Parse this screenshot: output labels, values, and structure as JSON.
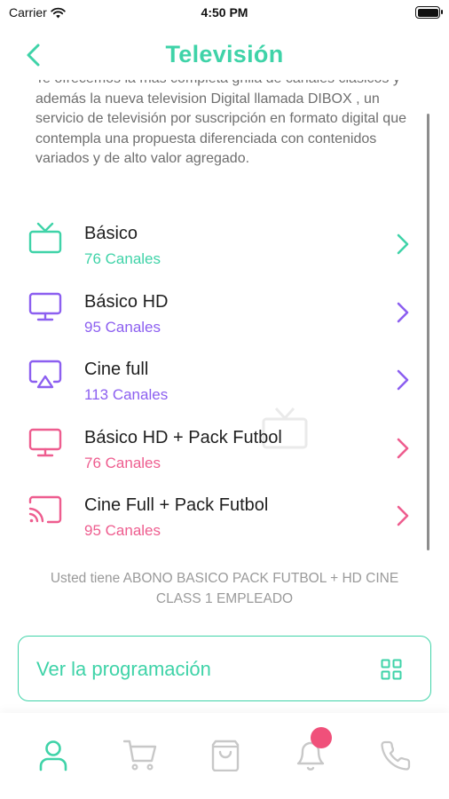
{
  "status_bar": {
    "carrier": "Carrier",
    "time": "4:50 PM"
  },
  "header": {
    "title": "Televisión"
  },
  "description": "Te ofrecemos la más completa grilla de canales clásicos y además la nueva television Digital llamada DIBOX , un servicio de televisión por suscripción en formato digital que contempla una propuesta diferenciada con contenidos variados y de alto valor agregado.",
  "channels": [
    {
      "name": "Básico",
      "count": "76 Canales",
      "color": "#3fd3a8",
      "icon": "tv-icon"
    },
    {
      "name": "Básico HD",
      "count": "95 Canales",
      "color": "#8c5ff0",
      "icon": "monitor-icon"
    },
    {
      "name": "Cine full",
      "count": "113 Canales",
      "color": "#8c5ff0",
      "icon": "airplay-icon"
    },
    {
      "name": "Básico HD + Pack Futbol",
      "count": "76 Canales",
      "color": "#ee5d8f",
      "icon": "monitor-icon"
    },
    {
      "name": "Cine Full + Pack Futbol",
      "count": "95 Canales",
      "color": "#ee5d8f",
      "icon": "cast-icon"
    }
  ],
  "subscription_info": "Usted tiene ABONO BASICO PACK FUTBOL + HD CINE CLASS 1 EMPLEADO",
  "program_button": {
    "label": "Ver la programación"
  },
  "tabs": [
    {
      "name": "profile",
      "icon": "user-icon",
      "active": true
    },
    {
      "name": "cart",
      "icon": "cart-icon",
      "active": false
    },
    {
      "name": "bag",
      "icon": "shopping-bag-icon",
      "active": false
    },
    {
      "name": "notifications",
      "icon": "bell-icon",
      "active": false,
      "badge": true
    },
    {
      "name": "phone",
      "icon": "phone-icon",
      "active": false
    }
  ],
  "colors": {
    "accent": "#3fd3a8",
    "purple": "#8c5ff0",
    "pink": "#ee5d8f",
    "badge": "#f0507a",
    "inactive": "#c8c8c8"
  }
}
